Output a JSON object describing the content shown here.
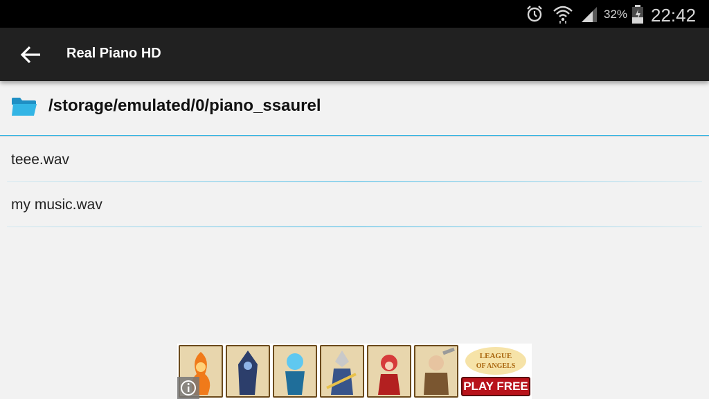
{
  "status_bar": {
    "battery_percent": "32%",
    "time": "22:42",
    "icons": [
      "alarm-icon",
      "wifi-icon",
      "signal-icon",
      "battery-icon"
    ]
  },
  "action_bar": {
    "back_icon": "arrow-left-icon",
    "title": "Real Piano HD"
  },
  "path": {
    "folder_icon": "folder-icon",
    "value": "/storage/emulated/0/piano_ssaurel"
  },
  "files": [
    {
      "name": "teee.wav"
    },
    {
      "name": "my music.wav"
    }
  ],
  "ad": {
    "logo_text": "LEAGUE OF ANGELS",
    "cta": "PLAY FREE",
    "info_icon": "info-icon"
  },
  "colors": {
    "status_bar": "#000000",
    "action_bar": "#212121",
    "background": "#f2f2f2",
    "accent_divider": "#33b5e5",
    "folder": "#33b5e5",
    "ad_cta": "#b8131b"
  }
}
